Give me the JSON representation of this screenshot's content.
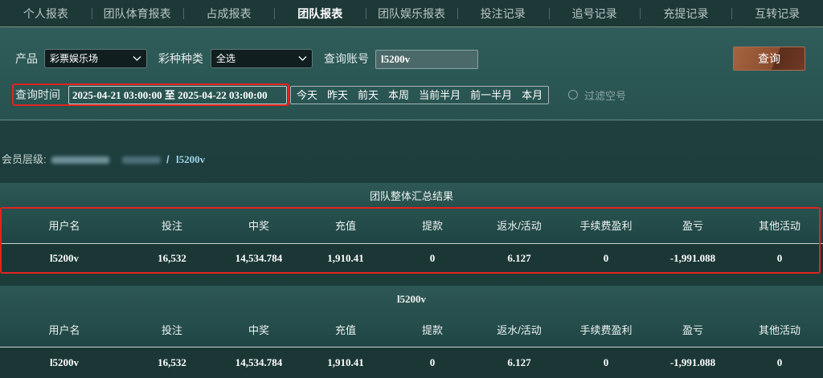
{
  "tabs": [
    {
      "label": "个人报表"
    },
    {
      "label": "团队体育报表"
    },
    {
      "label": "占成报表"
    },
    {
      "label": "团队报表"
    },
    {
      "label": "团队娱乐报表"
    },
    {
      "label": "投注记录"
    },
    {
      "label": "追号记录"
    },
    {
      "label": "充提记录"
    },
    {
      "label": "互转记录"
    }
  ],
  "active_tab": "团队报表",
  "filters": {
    "product": {
      "label": "产品",
      "value": "彩票娱乐场"
    },
    "lottery_type": {
      "label": "彩种种类",
      "value": "全选"
    },
    "account": {
      "label": "查询账号",
      "value": "l5200v"
    },
    "query_button": "查询",
    "time": {
      "label": "查询时间",
      "range": "2025-04-21 03:00:00 至 2025-04-22 03:00:00"
    },
    "quick_ranges": [
      "今天",
      "昨天",
      "前天",
      "本周",
      "当前半月",
      "前一半月",
      "本月"
    ],
    "filter_empty": {
      "label": "过滤空号",
      "checked": false
    }
  },
  "member_level": {
    "label": "会员层级:",
    "separator": "/",
    "current_user": "l5200v"
  },
  "summary": {
    "title": "团队整体汇总结果",
    "columns": [
      "用户名",
      "投注",
      "中奖",
      "充值",
      "提款",
      "返水/活动",
      "手续费盈利",
      "盈亏",
      "其他活动"
    ],
    "rows": [
      [
        "l5200v",
        "16,532",
        "14,534.784",
        "1,910.41",
        "0",
        "6.127",
        "0",
        "-1,991.088",
        "0"
      ]
    ]
  },
  "detail": {
    "title": "l5200v",
    "columns": [
      "用户名",
      "投注",
      "中奖",
      "充值",
      "提款",
      "返水/活动",
      "手续费盈利",
      "盈亏",
      "其他活动"
    ],
    "rows": [
      [
        "l5200v",
        "16,532",
        "14,534.784",
        "1,910.41",
        "0",
        "6.127",
        "0",
        "-1,991.088",
        "0"
      ]
    ]
  },
  "colors": {
    "highlight": "#e3231f",
    "query_button": "#8b4d2f",
    "member_link": "#9ed0ea",
    "background": "#1f4240"
  }
}
